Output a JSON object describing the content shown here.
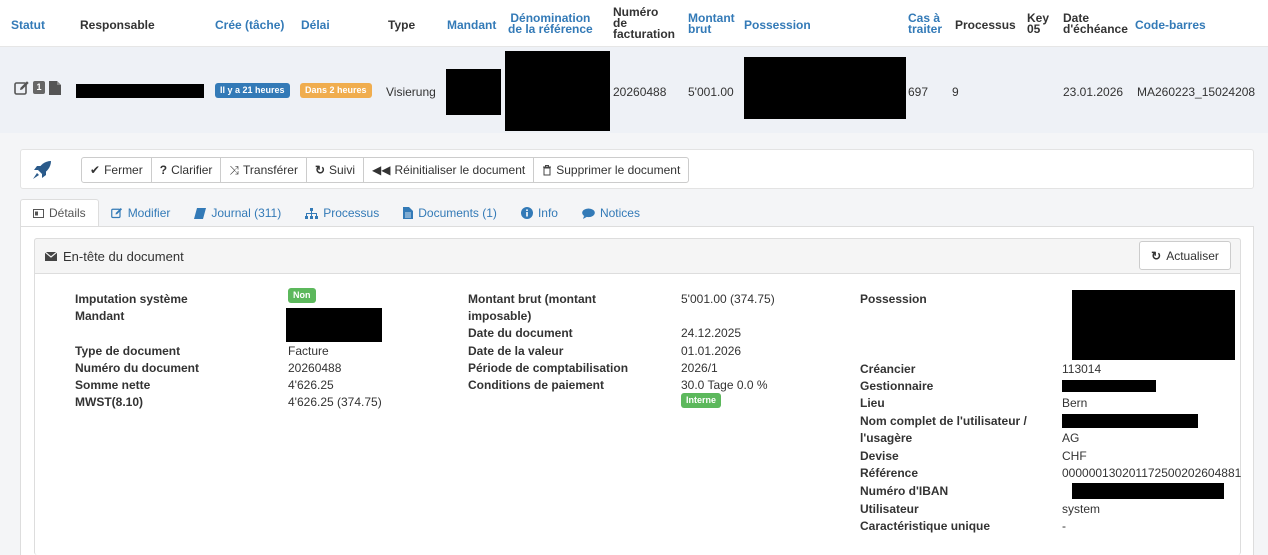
{
  "header": {
    "cols": {
      "statut": "Statut",
      "responsable": "Responsable",
      "cree_tache": "Crée (tâche)",
      "delai": "Délai",
      "type": "Type",
      "mandant": "Mandant",
      "denomination_1": "Dénomination",
      "denomination_2": "de la référence",
      "numero_1": "Numéro",
      "numero_2": "de",
      "numero_3": "facturation",
      "montant_1": "Montant",
      "montant_2": "brut",
      "possession": "Possession",
      "cas_1": "Cas à",
      "cas_2": "traiter",
      "processus": "Processus",
      "key_1": "Key",
      "key_2": "05",
      "date_1": "Date",
      "date_2": "d'échéance",
      "code_barres": "Code-barres"
    }
  },
  "row": {
    "created_badge": "Il y a 21 heures",
    "delay_badge": "Dans 2 heures",
    "type": "Visierung",
    "numero": "20260488",
    "montant": "5'001.00",
    "cas": "697",
    "processus": "9",
    "date_echeance": "23.01.2026",
    "code_barres": "MA260223_15024208",
    "icon_badge": "1"
  },
  "toolbar": {
    "fermer": "Fermer",
    "clarifier": "Clarifier",
    "transferer": "Transférer",
    "suivi": "Suivi",
    "reinit": "Réinitialiser le document",
    "supprimer": "Supprimer le document"
  },
  "tabs": {
    "details": "Détails",
    "modifier": "Modifier",
    "journal": "Journal (311)",
    "processus": "Processus",
    "documents": "Documents (1)",
    "info": "Info",
    "notices": "Notices"
  },
  "section": {
    "title": "En-tête du document",
    "refresh": "Actualiser"
  },
  "fields": {
    "imputation_label": "Imputation système",
    "imputation_badge": "Non",
    "mandant_label": "Mandant",
    "type_doc_label": "Type de document",
    "type_doc_value": "Facture",
    "numero_doc_label": "Numéro du document",
    "numero_doc_value": "20260488",
    "somme_label": "Somme nette",
    "somme_value": "4'626.25",
    "mwst_label": "MWST(8.10)",
    "mwst_value": "4'626.25 (374.75)",
    "montant_label_1": "Montant brut (montant",
    "montant_label_2": "imposable)",
    "montant_value": "5'001.00 (374.75)",
    "date_doc_label": "Date du document",
    "date_doc_value": "24.12.2025",
    "date_valeur_label": "Date de la valeur",
    "date_valeur_value": "01.01.2026",
    "periode_label": "Période de comptabilisation",
    "periode_value": "2026/1",
    "conditions_label": "Conditions de paiement",
    "conditions_value": "30.0 Tage 0.0 %",
    "conditions_badge": "Interne",
    "possession_label": "Possession",
    "creancier_label": "Créancier",
    "creancier_value": "113014",
    "gestionnaire_label": "Gestionnaire",
    "lieu_label": "Lieu",
    "lieu_value": "Bern",
    "nom_label_1": "Nom complet de l'utilisateur /",
    "nom_label_2": "l'usagère",
    "nom_value": "AG",
    "devise_label": "Devise",
    "devise_value": "CHF",
    "reference_label": "Référence",
    "reference_value": "000000130201172500202604881",
    "iban_label": "Numéro d'IBAN",
    "utilisateur_label": "Utilisateur",
    "utilisateur_value": "system",
    "caracteristique_label": "Caractéristique unique",
    "caracteristique_value": "-"
  },
  "colors": {
    "link": "#337ab7",
    "badge_blue": "#337ab7",
    "badge_orange": "#f0ad4e",
    "badge_green": "#5cb85c",
    "row_bg": "#eef1f6"
  },
  "icons": {
    "edit": "edit-icon",
    "document": "document-icon",
    "rocket": "rocket-icon",
    "check": "check-icon",
    "question": "question-icon",
    "shuffle": "shuffle-icon",
    "refresh": "refresh-icon",
    "rewind": "rewind-icon",
    "trash": "trash-icon",
    "envelope": "envelope-icon"
  }
}
